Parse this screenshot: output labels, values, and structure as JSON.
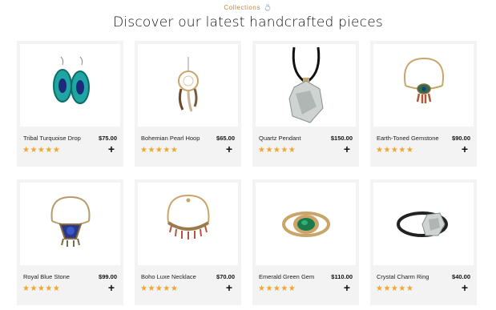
{
  "header": {
    "eyebrow": "Collections",
    "title": "Discover our latest handcrafted pieces"
  },
  "colors": {
    "star": "#f0a52b",
    "accent": "#b98a4a"
  },
  "products": [
    {
      "name": "Tribal Turquoise Drop",
      "price": "$75.00",
      "rating": 5,
      "icon": "turquoise-earrings"
    },
    {
      "name": "Bohemian Pearl Hoop",
      "price": "$65.00",
      "rating": 5,
      "icon": "dreamcatcher-earring"
    },
    {
      "name": "Quartz Pendant",
      "price": "$150.00",
      "rating": 5,
      "icon": "quartz-pendant"
    },
    {
      "name": "Earth-Toned Gemstone",
      "price": "$90.00",
      "rating": 5,
      "icon": "gemstone-necklace"
    },
    {
      "name": "Royal Blue Stone",
      "price": "$99.00",
      "rating": 5,
      "icon": "blue-stone-necklace"
    },
    {
      "name": "Boho Luxe Necklace",
      "price": "$70.00",
      "rating": 5,
      "icon": "boho-necklace"
    },
    {
      "name": "Emerald Green Gem",
      "price": "$110.00",
      "rating": 5,
      "icon": "emerald-ring"
    },
    {
      "name": "Crystal Charm Ring",
      "price": "$40.00",
      "rating": 5,
      "icon": "crystal-ring"
    }
  ],
  "stars_text": "★★★★★",
  "add_label": "+"
}
